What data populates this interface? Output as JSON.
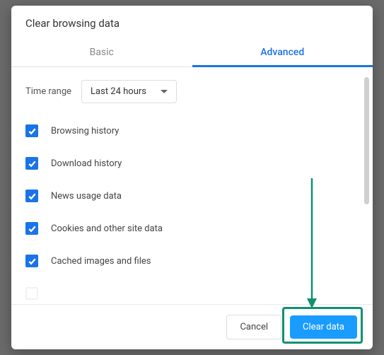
{
  "dialog": {
    "title": "Clear browsing data"
  },
  "tabs": {
    "basic": "Basic",
    "advanced": "Advanced",
    "active": "advanced"
  },
  "timeRange": {
    "label": "Time range",
    "selected": "Last 24 hours"
  },
  "items": [
    {
      "label": "Browsing history",
      "checked": true
    },
    {
      "label": "Download history",
      "checked": true
    },
    {
      "label": "News usage data",
      "checked": true
    },
    {
      "label": "Cookies and other site data",
      "checked": true
    },
    {
      "label": "Cached images and files",
      "checked": true
    },
    {
      "label": "",
      "checked": false
    }
  ],
  "footer": {
    "cancel": "Cancel",
    "clear": "Clear data"
  },
  "annotation": {
    "arrowColor": "#0d9171",
    "highlightColor": "#0d9171"
  }
}
